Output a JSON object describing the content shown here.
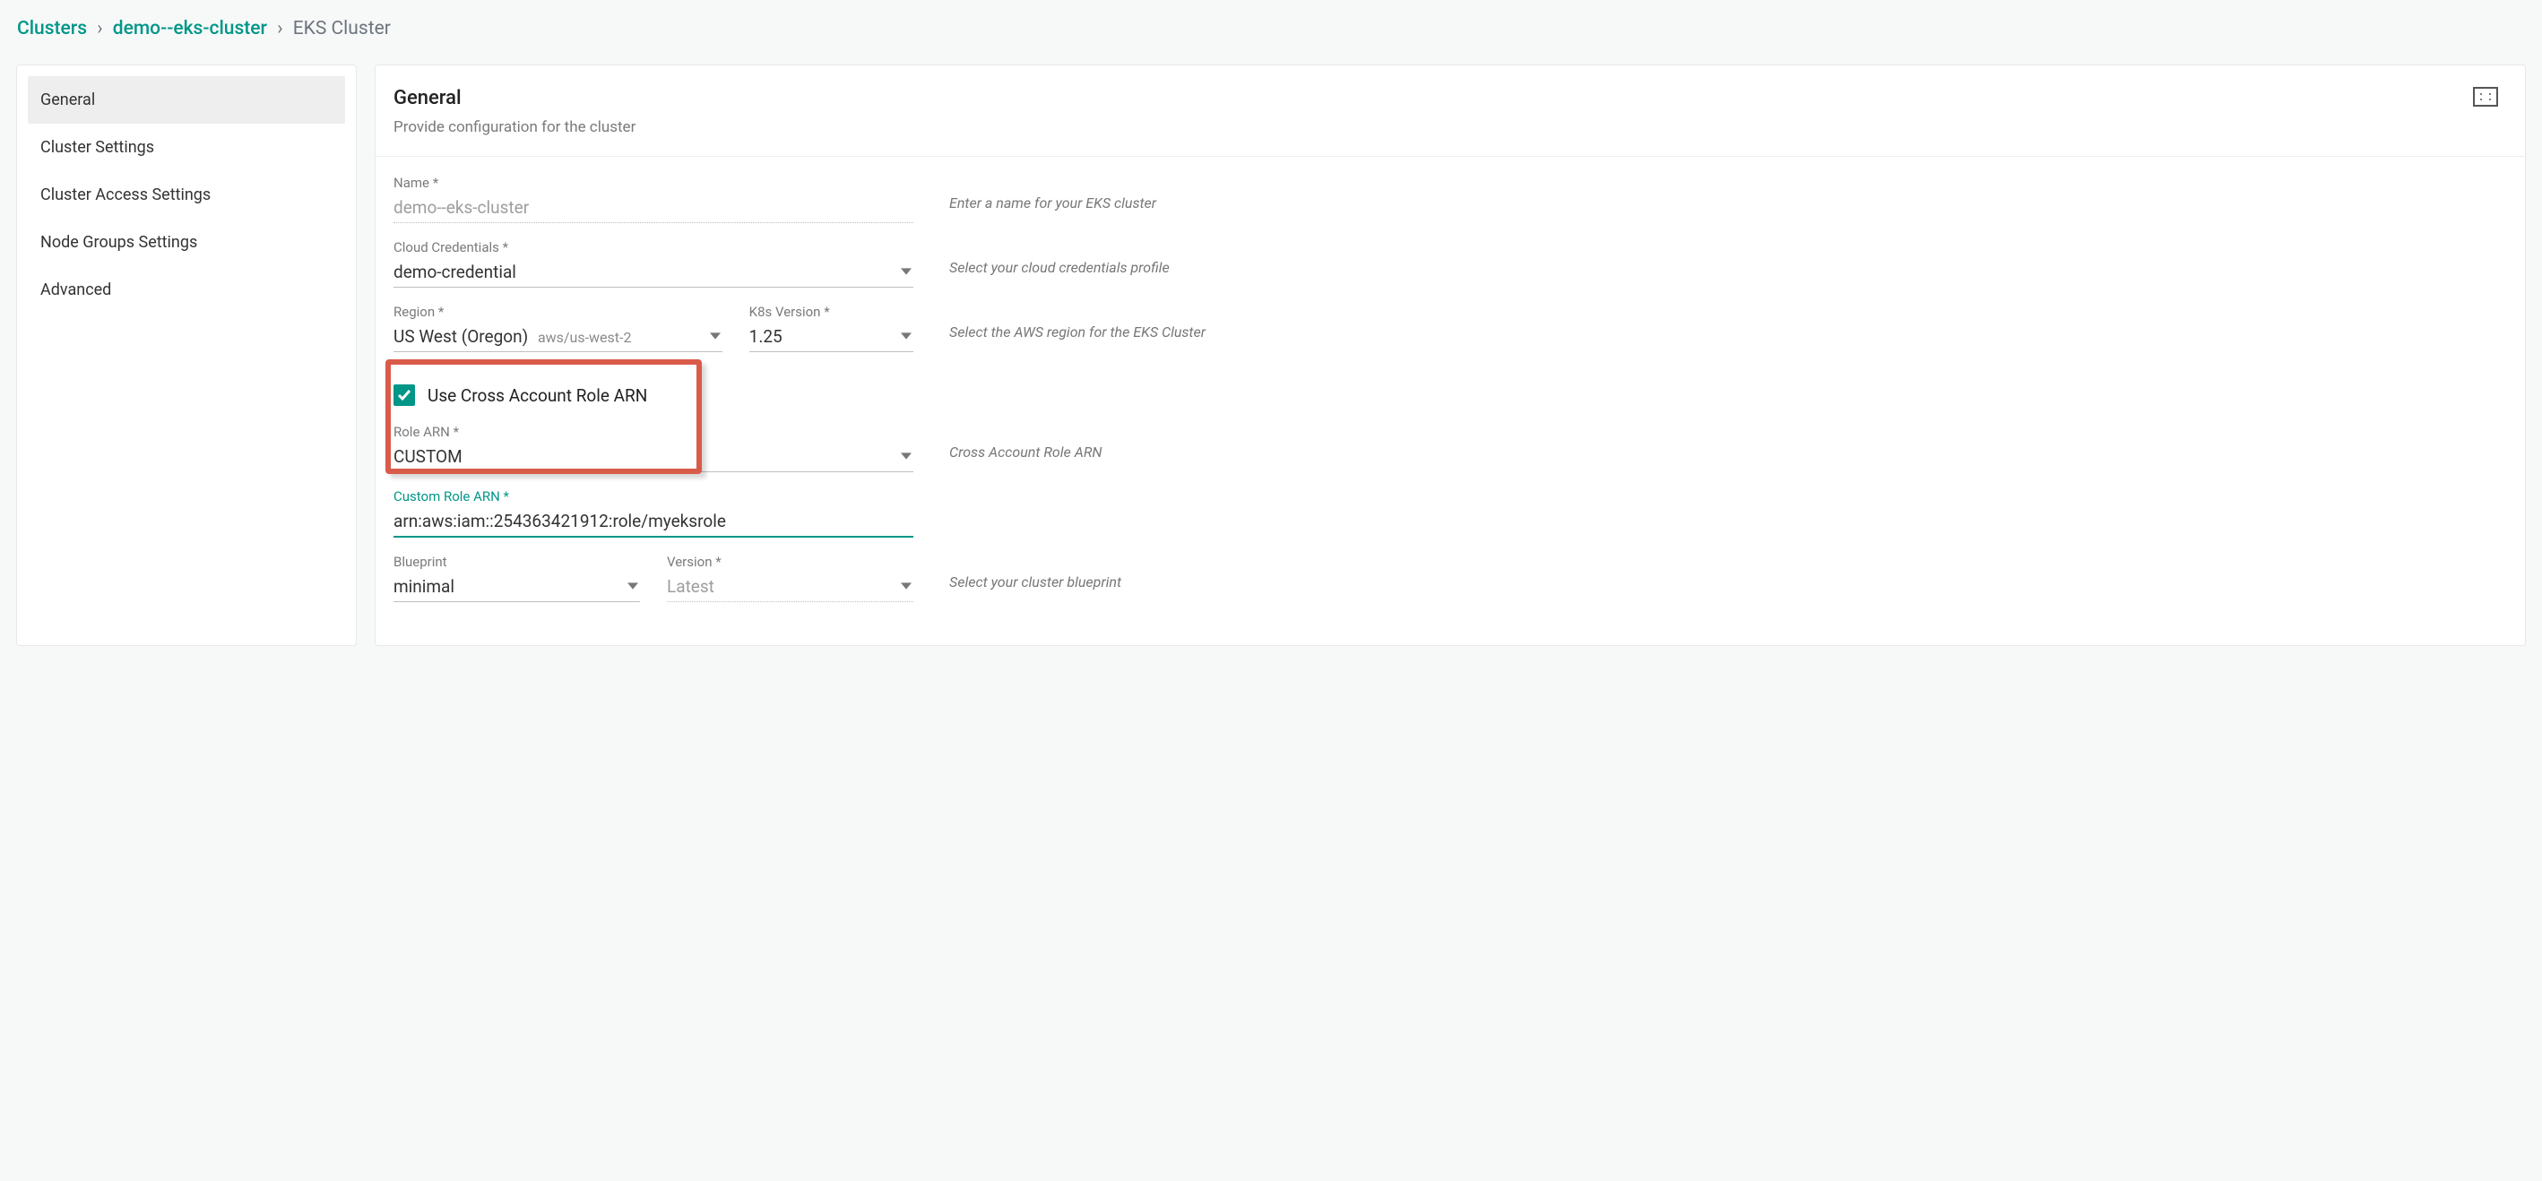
{
  "breadcrumb": {
    "root": "Clusters",
    "mid": "demo--eks-cluster",
    "current": "EKS Cluster"
  },
  "sidebar": {
    "items": [
      {
        "label": "General",
        "active": true
      },
      {
        "label": "Cluster Settings",
        "active": false
      },
      {
        "label": "Cluster Access Settings",
        "active": false
      },
      {
        "label": "Node Groups Settings",
        "active": false
      },
      {
        "label": "Advanced",
        "active": false
      }
    ]
  },
  "header": {
    "title": "General",
    "subtitle": "Provide configuration for the cluster"
  },
  "form": {
    "name_label": "Name *",
    "name_value": "demo--eks-cluster",
    "name_hint": "Enter a name for your EKS cluster",
    "cred_label": "Cloud Credentials *",
    "cred_value": "demo-credential",
    "cred_hint": "Select your cloud credentials profile",
    "region_label": "Region *",
    "region_value": "US West (Oregon)",
    "region_sub": "aws/us-west-2",
    "region_hint": "Select the AWS region for the EKS Cluster",
    "k8s_label": "K8s Version *",
    "k8s_value": "1.25",
    "cross_label": "Use Cross Account Role ARN",
    "cross_checked": true,
    "rolearn_label": "Role ARN *",
    "rolearn_value": "CUSTOM",
    "rolearn_hint": "Cross Account Role ARN",
    "custom_label": "Custom Role ARN *",
    "custom_value": "arn:aws:iam::254363421912:role/myeksrole",
    "blueprint_label": "Blueprint",
    "blueprint_value": "minimal",
    "blueprint_hint": "Select your cluster blueprint",
    "version_label": "Version *",
    "version_value": "Latest"
  }
}
